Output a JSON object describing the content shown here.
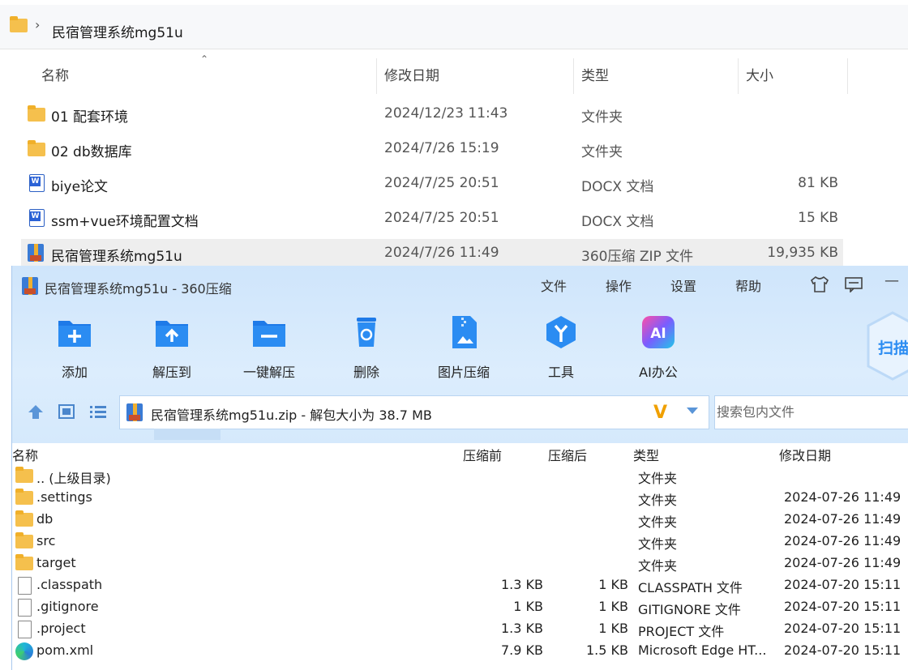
{
  "explorer": {
    "breadcrumb": {
      "path": "民宿管理系统mg51u"
    },
    "columns": {
      "name": "名称",
      "date": "修改日期",
      "type": "类型",
      "size": "大小"
    },
    "rows": [
      {
        "name": "01 配套环境",
        "date": "2024/12/23 11:43",
        "type": "文件夹",
        "size": "",
        "icon": "folder-icon"
      },
      {
        "name": "02 db数据库",
        "date": "2024/7/26 15:19",
        "type": "文件夹",
        "size": "",
        "icon": "folder-icon"
      },
      {
        "name": "biye论文",
        "date": "2024/7/25 20:51",
        "type": "DOCX 文档",
        "size": "81 KB",
        "icon": "word-doc-icon"
      },
      {
        "name": "ssm+vue环境配置文档",
        "date": "2024/7/25 20:51",
        "type": "DOCX 文档",
        "size": "15 KB",
        "icon": "word-doc-icon"
      },
      {
        "name": "民宿管理系统mg51u",
        "date": "2024/7/26 11:49",
        "type": "360压缩 ZIP 文件",
        "size": "19,935 KB",
        "icon": "zip-archive-icon"
      }
    ]
  },
  "zip_window": {
    "title": "民宿管理系统mg51u - 360压缩",
    "menu": [
      "文件",
      "操作",
      "设置",
      "帮助"
    ],
    "tools": [
      {
        "label": "添加",
        "icon": "add-folder-icon"
      },
      {
        "label": "解压到",
        "icon": "extract-to-icon"
      },
      {
        "label": "一键解压",
        "icon": "one-click-extract-icon"
      },
      {
        "label": "删除",
        "icon": "recycle-bin-icon"
      },
      {
        "label": "图片压缩",
        "icon": "image-compress-icon"
      },
      {
        "label": "工具",
        "icon": "tools-icon"
      },
      {
        "label": "AI办公",
        "icon": "ai-office-icon"
      }
    ],
    "scan_badge": "扫描",
    "path_text": "民宿管理系统mg51u.zip - 解包大小为 38.7 MB",
    "search_placeholder": "搜索包内文件",
    "columns": {
      "name": "名称",
      "before": "压缩前",
      "after": "压缩后",
      "type": "类型",
      "date": "修改日期"
    },
    "rows": [
      {
        "name": ".. (上级目录)",
        "before": "",
        "after": "",
        "type": "文件夹",
        "date": "",
        "icon": "folder"
      },
      {
        "name": ".settings",
        "before": "",
        "after": "",
        "type": "文件夹",
        "date": "2024-07-26 11:49",
        "icon": "folder"
      },
      {
        "name": "db",
        "before": "",
        "after": "",
        "type": "文件夹",
        "date": "2024-07-26 11:49",
        "icon": "folder"
      },
      {
        "name": "src",
        "before": "",
        "after": "",
        "type": "文件夹",
        "date": "2024-07-26 11:49",
        "icon": "folder"
      },
      {
        "name": "target",
        "before": "",
        "after": "",
        "type": "文件夹",
        "date": "2024-07-26 11:49",
        "icon": "folder"
      },
      {
        "name": ".classpath",
        "before": "1.3 KB",
        "after": "1 KB",
        "type": "CLASSPATH 文件",
        "date": "2024-07-20 15:11",
        "icon": "file"
      },
      {
        "name": ".gitignore",
        "before": "1 KB",
        "after": "1 KB",
        "type": "GITIGNORE 文件",
        "date": "2024-07-20 15:11",
        "icon": "file"
      },
      {
        "name": ".project",
        "before": "1.3 KB",
        "after": "1 KB",
        "type": "PROJECT 文件",
        "date": "2024-07-20 15:11",
        "icon": "file"
      },
      {
        "name": "pom.xml",
        "before": "7.9 KB",
        "after": "1.5 KB",
        "type": "Microsoft Edge HT...",
        "date": "2024-07-20 15:11",
        "icon": "edge"
      }
    ]
  }
}
